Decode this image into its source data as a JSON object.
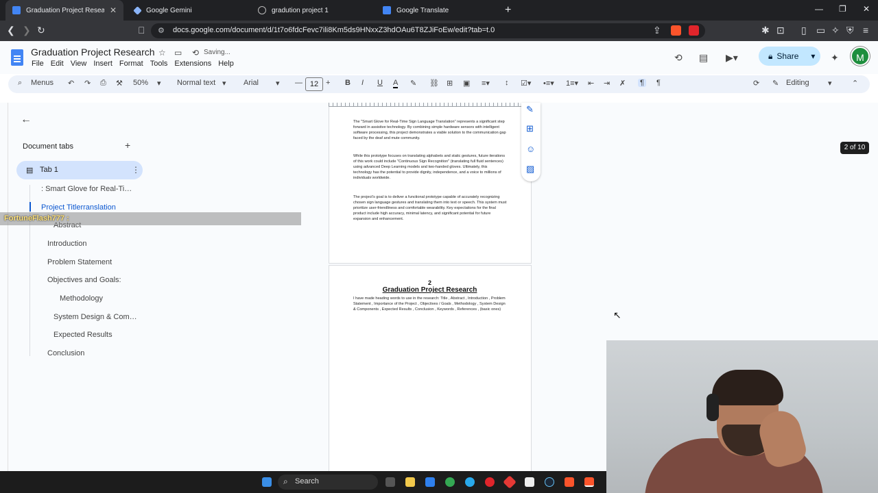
{
  "browser": {
    "tabs": [
      {
        "title": "Graduation Project Research - Goo…",
        "active": true
      },
      {
        "title": "Google Gemini",
        "active": false
      },
      {
        "title": "gradution project 1",
        "active": false
      },
      {
        "title": "Google Translate",
        "active": false
      }
    ],
    "new_tab": "+",
    "url": "docs.google.com/document/d/1t7o6fdcFevc7ili8Km5ds9HNxxZ3hdOAu6T8ZJiFoEw/edit?tab=t.0"
  },
  "doc": {
    "title": "Graduation Project Research",
    "status": "Saving...",
    "menu": [
      "File",
      "Edit",
      "View",
      "Insert",
      "Format",
      "Tools",
      "Extensions",
      "Help"
    ],
    "share_label": "Share",
    "avatar_letter": "M"
  },
  "toolbar": {
    "menus_label": "Menus",
    "zoom": "50%",
    "style": "Normal text",
    "font": "Arial",
    "font_size": "12",
    "mode": "Editing"
  },
  "outline": {
    "doc_tabs_label": "Document tabs",
    "tab_name": "Tab 1",
    "items": [
      {
        "label": ": Smart Glove for Real-Ti…"
      },
      {
        "label": "Project Titlerranslation"
      },
      {
        "label": "Abstract"
      },
      {
        "label": "Introduction"
      },
      {
        "label": "Problem Statement"
      },
      {
        "label": "Objectives and Goals:"
      },
      {
        "label": "Methodology"
      },
      {
        "label": "System Design & Com…"
      },
      {
        "label": "Expected Results"
      },
      {
        "label": "Conclusion"
      }
    ]
  },
  "overlay": {
    "username": "FortuneFlash777 :"
  },
  "page1": {
    "paragraphs": [
      "The \"Smart Glove for Real-Time Sign Language Translation\" represents a significant step forward in assistive technology. By combining simple hardware sensors with intelligent software processing, this project demonstrates a viable solution to the communication gap faced by the deaf and mute community.",
      "While this prototype focuses on translating alphabets and static gestures, future iterations of this work could include \"Continuous Sign Recognition\" (translating full fluid sentences) using advanced Deep Learning models and two-handed gloves. Ultimately, this technology has the potential to provide dignity, independence, and a voice to millions of individuals worldwide.",
      "The project's goal is to deliver a functional prototype capable of accurately recognizing chosen sign language gestures and translating them into text or speech. This system must prioritize user-friendliness and comfortable wearability. Key expectations for the final product include high accuracy, minimal latency, and significant potential for future expansion and enhancement."
    ]
  },
  "page2": {
    "number": "2",
    "title": "Graduation Project Research",
    "body": "I have made heading words to use in the research: Title , Abstract , Introduction , Problem Statement , Importance of the Project , Objectives / Goals , Methodology , System Design & Components , Expected Results , Conclusion , Keywords , References , (basic ones)"
  },
  "page_counter": "2 of 10",
  "taskbar": {
    "search_label": "Search"
  },
  "colors": {
    "accent": "#0b57d0",
    "share_bg": "#c2e7ff",
    "tab_active_bg": "#d3e3fd",
    "avatar": "#1e8e3e"
  }
}
